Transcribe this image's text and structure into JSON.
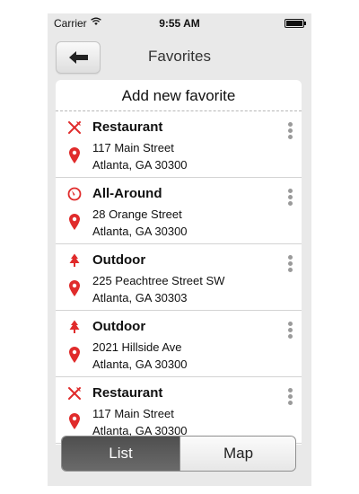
{
  "status_bar": {
    "carrier": "Carrier",
    "time": "9:55 AM"
  },
  "header": {
    "title": "Favorites",
    "back_icon": "arrow-left-icon"
  },
  "add_favorite_label": "Add new favorite",
  "accent_color": "#e02b2b",
  "favorites": [
    {
      "category": "Restaurant",
      "icon": "fork-knife-icon",
      "street": "117 Main Street",
      "city": "Atlanta, GA 30300"
    },
    {
      "category": "All-Around",
      "icon": "compass-icon",
      "street": "28 Orange Street",
      "city": "Atlanta, GA 30300"
    },
    {
      "category": "Outdoor",
      "icon": "tree-icon",
      "street": "225 Peachtree Street SW",
      "city": "Atlanta, GA 30303"
    },
    {
      "category": "Outdoor",
      "icon": "tree-icon",
      "street": "2021 Hillside Ave",
      "city": "Atlanta, GA 30300"
    },
    {
      "category": "Restaurant",
      "icon": "fork-knife-icon",
      "street": "117 Main Street",
      "city": "Atlanta, GA 30300"
    }
  ],
  "segmented_control": {
    "options": [
      "List",
      "Map"
    ],
    "selected": "List"
  }
}
